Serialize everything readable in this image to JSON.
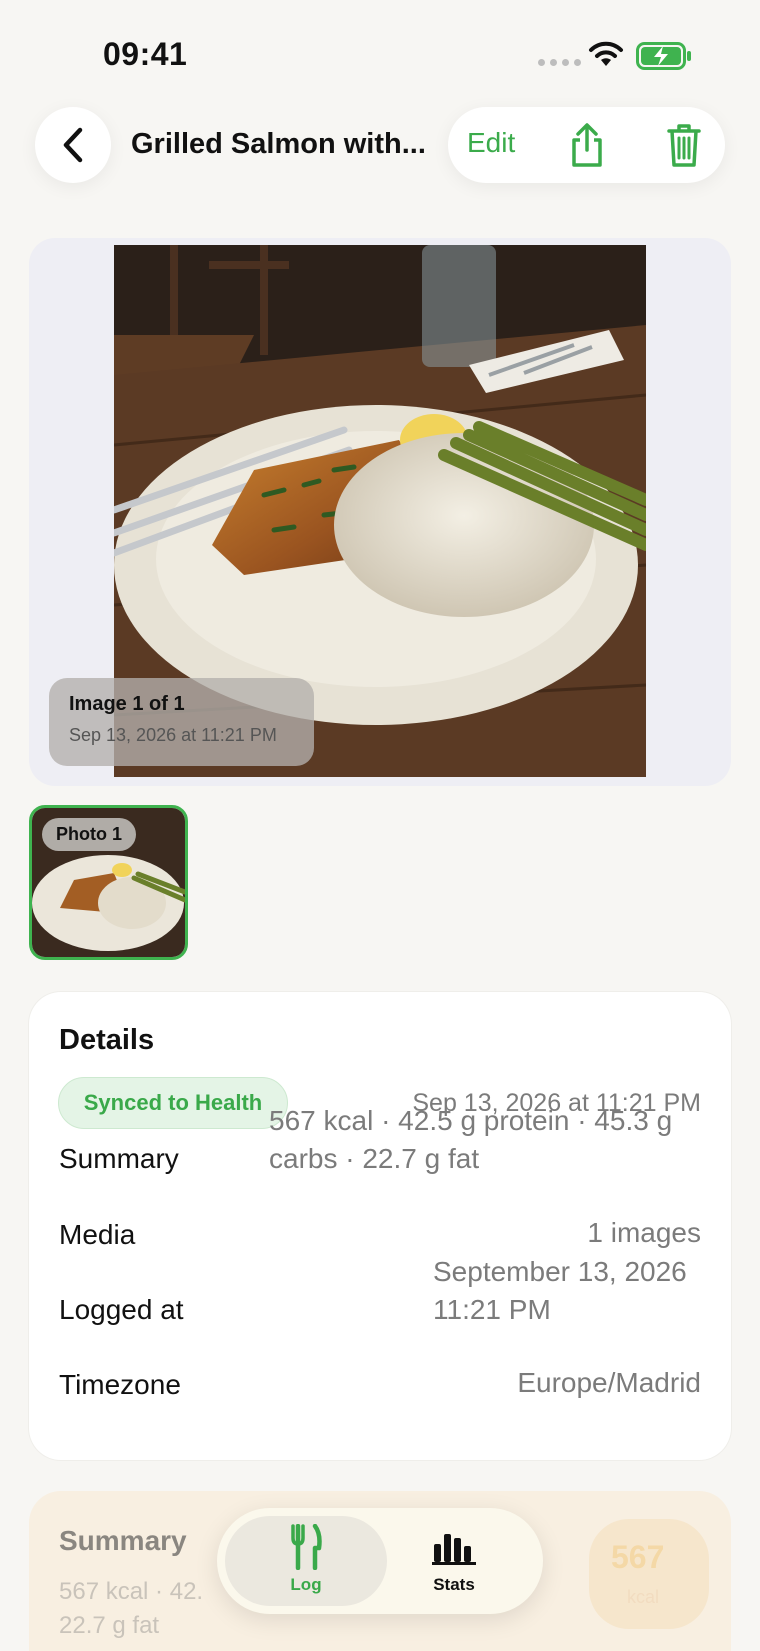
{
  "status_bar": {
    "time": "09:41"
  },
  "nav": {
    "title": "Grilled Salmon with...",
    "edit_label": "Edit"
  },
  "image_viewer": {
    "caption_title": "Image 1 of 1",
    "caption_date": "Sep 13, 2026 at 11:21 PM"
  },
  "thumbnails": [
    {
      "label": "Photo 1",
      "selected": true
    }
  ],
  "details": {
    "title": "Details",
    "badge": "Synced to Health",
    "date": "Sep 13, 2026 at 11:21 PM",
    "rows": [
      {
        "label": "Summary",
        "value_line1": "567 kcal · 42.5 g protein · 45.3 g",
        "value_line2": "carbs · 22.7 g fat"
      },
      {
        "label": "Media",
        "value": "1 images"
      },
      {
        "label": "Logged at",
        "value_line1": "September 13, 2026",
        "value_line2": "11:21 PM"
      },
      {
        "label": "Timezone",
        "value": "Europe/Madrid"
      }
    ]
  },
  "summary_card": {
    "title": "Summary",
    "line1": "567 kcal · 42.",
    "line2": "22.7 g fat",
    "kcal": "567",
    "kcal_unit": "kcal"
  },
  "tabs": [
    {
      "label": "Log",
      "icon": "fork-knife-icon",
      "active": true
    },
    {
      "label": "Stats",
      "icon": "bar-chart-icon",
      "active": false
    }
  ],
  "colors": {
    "accent": "#3bab4b",
    "background": "#f7f6f3",
    "card": "#ffffff"
  }
}
